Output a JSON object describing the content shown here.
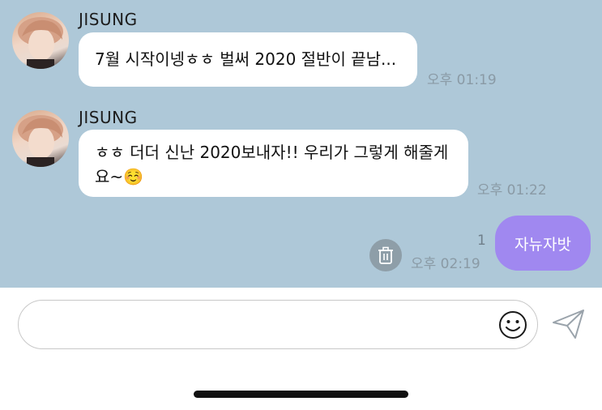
{
  "messages": [
    {
      "sender": "JISUNG",
      "text": "7월 시작이넹ㅎㅎ 벌써 2020 절반이 끝남...",
      "time": "오후 01:19"
    },
    {
      "sender": "JISUNG",
      "text_line1": "ㅎㅎ 더더 신난 2020보내자!! 우리가 그렇게 해줄게",
      "text_line2": "요~☺️",
      "time": "오후 01:22"
    }
  ],
  "my_message": {
    "text": "자뉴자밧",
    "unread_count": "1",
    "time": "오후 02:19"
  },
  "composer": {
    "placeholder": ""
  },
  "icons": {
    "delete": "trash-icon",
    "emoji": "smiley-icon",
    "send": "paper-plane-icon"
  },
  "colors": {
    "chat_background": "#aec8d8",
    "my_bubble": "#a088f0",
    "their_bubble": "#ffffff"
  }
}
